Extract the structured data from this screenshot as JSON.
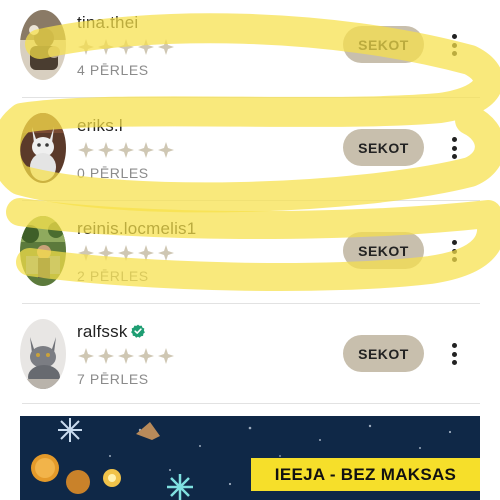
{
  "users": [
    {
      "username": "tina.thei",
      "perles": "4 PĒRLES",
      "follow_label": "SEKOT",
      "verified": false,
      "avatar_icon": "user-photo-icon"
    },
    {
      "username": "eriks.l",
      "perles": "0 PĒRLES",
      "follow_label": "SEKOT",
      "verified": false,
      "avatar_icon": "cat-photo-icon"
    },
    {
      "username": "reinis.locmelis1",
      "perles": "2 PĒRLES",
      "follow_label": "SEKOT",
      "verified": false,
      "avatar_icon": "user-photo-icon"
    },
    {
      "username": "ralfssk",
      "perles": "7 PĒRLES",
      "follow_label": "SEKOT",
      "verified": true,
      "avatar_icon": "cat-photo-icon"
    }
  ],
  "star_icon": "pearl-star-icon",
  "star_count": 5,
  "banner": {
    "label": "IEEJA - BEZ MAKSAS"
  },
  "colors": {
    "follow_button": "#c8bfad",
    "highlight": "#f7e04a",
    "verified": "#1f9e73",
    "banner_label_bg": "#f6df2a"
  }
}
